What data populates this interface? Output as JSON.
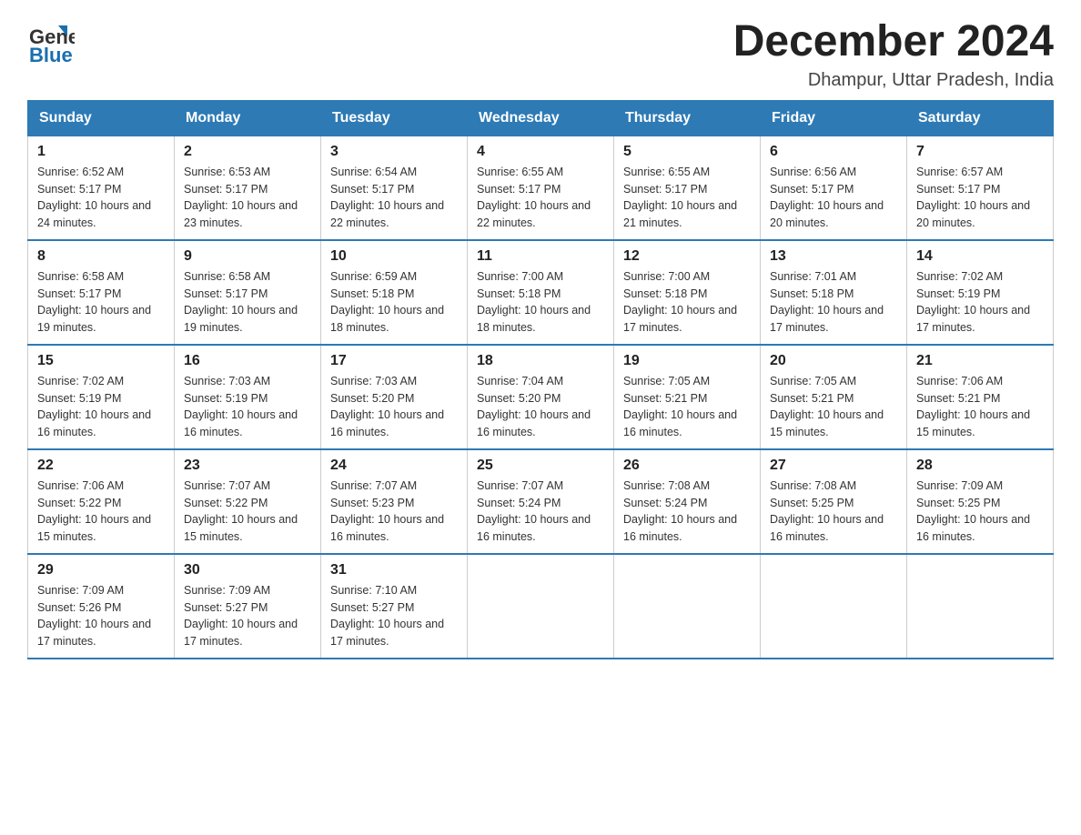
{
  "logo": {
    "text_general": "General",
    "text_blue": "Blue"
  },
  "title": "December 2024",
  "subtitle": "Dhampur, Uttar Pradesh, India",
  "header_colors": {
    "bg": "#2d7ab5"
  },
  "days_of_week": [
    "Sunday",
    "Monday",
    "Tuesday",
    "Wednesday",
    "Thursday",
    "Friday",
    "Saturday"
  ],
  "weeks": [
    [
      {
        "day": "1",
        "sunrise": "6:52 AM",
        "sunset": "5:17 PM",
        "daylight": "10 hours and 24 minutes."
      },
      {
        "day": "2",
        "sunrise": "6:53 AM",
        "sunset": "5:17 PM",
        "daylight": "10 hours and 23 minutes."
      },
      {
        "day": "3",
        "sunrise": "6:54 AM",
        "sunset": "5:17 PM",
        "daylight": "10 hours and 22 minutes."
      },
      {
        "day": "4",
        "sunrise": "6:55 AM",
        "sunset": "5:17 PM",
        "daylight": "10 hours and 22 minutes."
      },
      {
        "day": "5",
        "sunrise": "6:55 AM",
        "sunset": "5:17 PM",
        "daylight": "10 hours and 21 minutes."
      },
      {
        "day": "6",
        "sunrise": "6:56 AM",
        "sunset": "5:17 PM",
        "daylight": "10 hours and 20 minutes."
      },
      {
        "day": "7",
        "sunrise": "6:57 AM",
        "sunset": "5:17 PM",
        "daylight": "10 hours and 20 minutes."
      }
    ],
    [
      {
        "day": "8",
        "sunrise": "6:58 AM",
        "sunset": "5:17 PM",
        "daylight": "10 hours and 19 minutes."
      },
      {
        "day": "9",
        "sunrise": "6:58 AM",
        "sunset": "5:17 PM",
        "daylight": "10 hours and 19 minutes."
      },
      {
        "day": "10",
        "sunrise": "6:59 AM",
        "sunset": "5:18 PM",
        "daylight": "10 hours and 18 minutes."
      },
      {
        "day": "11",
        "sunrise": "7:00 AM",
        "sunset": "5:18 PM",
        "daylight": "10 hours and 18 minutes."
      },
      {
        "day": "12",
        "sunrise": "7:00 AM",
        "sunset": "5:18 PM",
        "daylight": "10 hours and 17 minutes."
      },
      {
        "day": "13",
        "sunrise": "7:01 AM",
        "sunset": "5:18 PM",
        "daylight": "10 hours and 17 minutes."
      },
      {
        "day": "14",
        "sunrise": "7:02 AM",
        "sunset": "5:19 PM",
        "daylight": "10 hours and 17 minutes."
      }
    ],
    [
      {
        "day": "15",
        "sunrise": "7:02 AM",
        "sunset": "5:19 PM",
        "daylight": "10 hours and 16 minutes."
      },
      {
        "day": "16",
        "sunrise": "7:03 AM",
        "sunset": "5:19 PM",
        "daylight": "10 hours and 16 minutes."
      },
      {
        "day": "17",
        "sunrise": "7:03 AM",
        "sunset": "5:20 PM",
        "daylight": "10 hours and 16 minutes."
      },
      {
        "day": "18",
        "sunrise": "7:04 AM",
        "sunset": "5:20 PM",
        "daylight": "10 hours and 16 minutes."
      },
      {
        "day": "19",
        "sunrise": "7:05 AM",
        "sunset": "5:21 PM",
        "daylight": "10 hours and 16 minutes."
      },
      {
        "day": "20",
        "sunrise": "7:05 AM",
        "sunset": "5:21 PM",
        "daylight": "10 hours and 15 minutes."
      },
      {
        "day": "21",
        "sunrise": "7:06 AM",
        "sunset": "5:21 PM",
        "daylight": "10 hours and 15 minutes."
      }
    ],
    [
      {
        "day": "22",
        "sunrise": "7:06 AM",
        "sunset": "5:22 PM",
        "daylight": "10 hours and 15 minutes."
      },
      {
        "day": "23",
        "sunrise": "7:07 AM",
        "sunset": "5:22 PM",
        "daylight": "10 hours and 15 minutes."
      },
      {
        "day": "24",
        "sunrise": "7:07 AM",
        "sunset": "5:23 PM",
        "daylight": "10 hours and 16 minutes."
      },
      {
        "day": "25",
        "sunrise": "7:07 AM",
        "sunset": "5:24 PM",
        "daylight": "10 hours and 16 minutes."
      },
      {
        "day": "26",
        "sunrise": "7:08 AM",
        "sunset": "5:24 PM",
        "daylight": "10 hours and 16 minutes."
      },
      {
        "day": "27",
        "sunrise": "7:08 AM",
        "sunset": "5:25 PM",
        "daylight": "10 hours and 16 minutes."
      },
      {
        "day": "28",
        "sunrise": "7:09 AM",
        "sunset": "5:25 PM",
        "daylight": "10 hours and 16 minutes."
      }
    ],
    [
      {
        "day": "29",
        "sunrise": "7:09 AM",
        "sunset": "5:26 PM",
        "daylight": "10 hours and 17 minutes."
      },
      {
        "day": "30",
        "sunrise": "7:09 AM",
        "sunset": "5:27 PM",
        "daylight": "10 hours and 17 minutes."
      },
      {
        "day": "31",
        "sunrise": "7:10 AM",
        "sunset": "5:27 PM",
        "daylight": "10 hours and 17 minutes."
      },
      null,
      null,
      null,
      null
    ]
  ],
  "labels": {
    "sunrise": "Sunrise:",
    "sunset": "Sunset:",
    "daylight": "Daylight:"
  }
}
